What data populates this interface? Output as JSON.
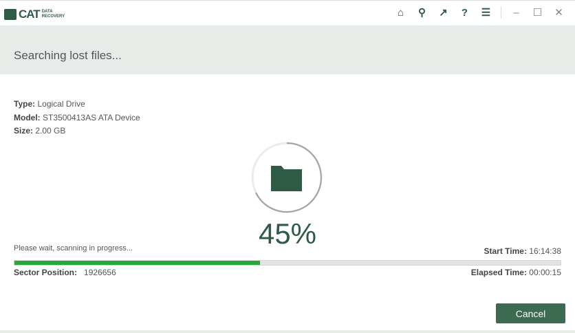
{
  "app": {
    "logo_text": "CAT",
    "logo_sub": "DATA RECOVERY"
  },
  "toolbar": {
    "icons": [
      "home-icon",
      "key-icon",
      "arrow-up-right-icon",
      "help-icon",
      "menu-icon"
    ],
    "minimize": "–",
    "maximize": "☐",
    "close": "✕"
  },
  "header": {
    "title": "Searching lost files..."
  },
  "drive": {
    "type_label": "Type:",
    "type": "Logical Drive",
    "model_label": "Model:",
    "model": "ST3500413AS ATA Device",
    "size_label": "Size:",
    "size": "2.00 GB"
  },
  "progress": {
    "percent_text": "45%",
    "value": 45,
    "status": "Please wait, scanning in progress...",
    "start_label": "Start Time",
    "start": "16:14:38",
    "sector_label": "Sector Position:",
    "sector": "1926656",
    "elapsed_label": "Elapsed Time",
    "elapsed": "00:00:15",
    "fill_color": "#26a83a"
  },
  "buttons": {
    "cancel": "Cancel"
  }
}
